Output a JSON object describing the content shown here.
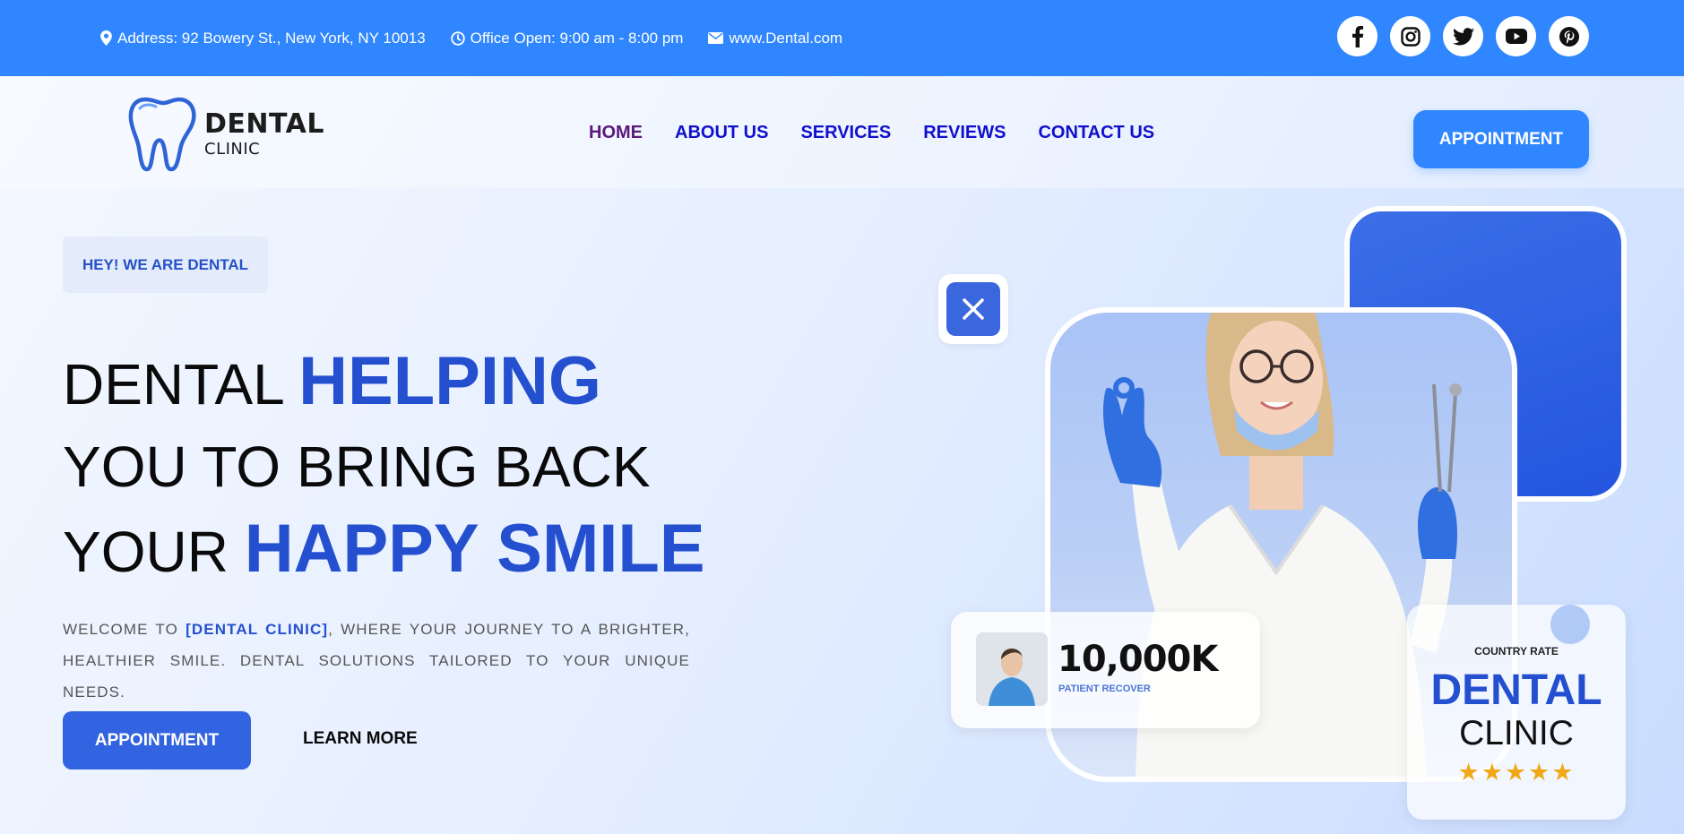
{
  "topbar": {
    "address": "Address: 92 Bowery St., New York, NY 10013",
    "hours": "Office Open: 9:00 am - 8:00 pm",
    "website": "www.Dental.com",
    "color": "#2f86ff",
    "socials": [
      "facebook-icon",
      "instagram-icon",
      "twitter-icon",
      "youtube-icon",
      "pinterest-icon"
    ]
  },
  "logo": {
    "main": "DENTAL",
    "sub": "CLINIC"
  },
  "nav": {
    "items": [
      {
        "label": "HOME",
        "active": true
      },
      {
        "label": "ABOUT US",
        "active": false
      },
      {
        "label": "SERVICES",
        "active": false
      },
      {
        "label": "REVIEWS",
        "active": false
      },
      {
        "label": "CONTACT US",
        "active": false
      }
    ],
    "cta": "APPOINTMENT"
  },
  "hero": {
    "tag": "HEY! WE ARE DENTAL",
    "line1_plain": "DENTAL ",
    "line1_accent": "HELPING",
    "line2": "YOU TO BRING BACK",
    "line3_plain": "YOUR ",
    "line3_accent": "HAPPY SMILE",
    "intro_pre": "WELCOME TO ",
    "intro_brand": "[DENTAL CLINIC]",
    "intro_post": ", WHERE YOUR JOURNEY TO A BRIGHTER, HEALTHIER SMILE. DENTAL SOLUTIONS TAILORED TO YOUR UNIQUE NEEDS.",
    "cta_primary": "APPOINTMENT",
    "cta_secondary": "LEARN MORE",
    "accent_color": "#2450d0"
  },
  "stat": {
    "value": "10,000K",
    "label": "PATIENT RECOVER"
  },
  "rating": {
    "title": "COUNTRY RATE",
    "main": "DENTAL",
    "sub": "CLINIC",
    "stars": "★★★★★",
    "star_count": 5
  }
}
